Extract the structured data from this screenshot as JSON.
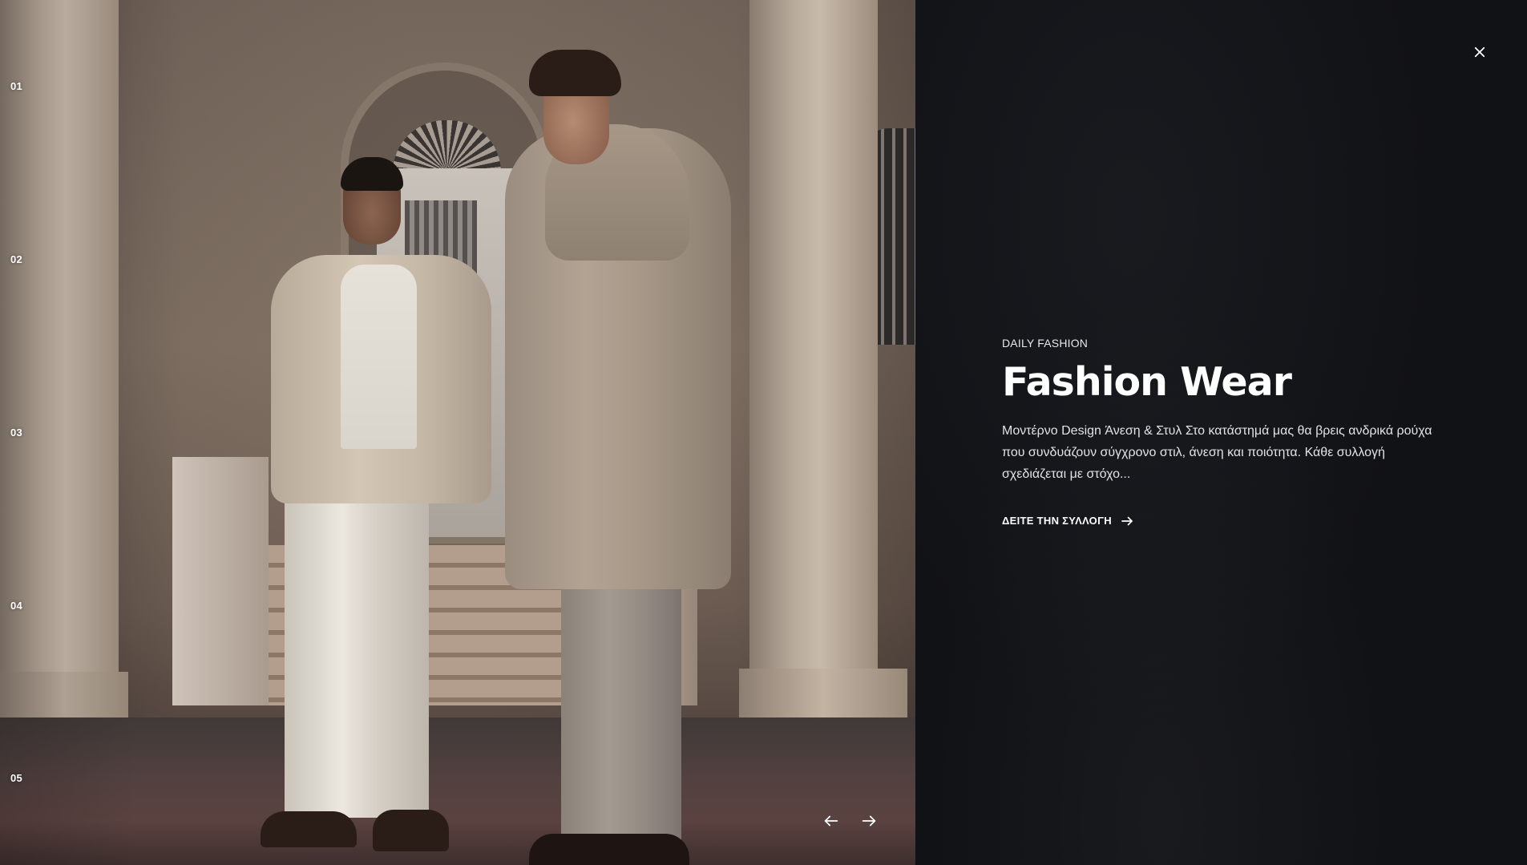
{
  "slider": {
    "numbers": [
      "01",
      "02",
      "03",
      "04",
      "05"
    ],
    "prev_icon": "arrow-left-icon",
    "next_icon": "arrow-right-icon"
  },
  "panel": {
    "close_icon": "close-icon",
    "eyebrow": "DAILY FASHION",
    "title": "Fashion Wear",
    "description": "Μοντέρνο Design Άνεση & Στυλ Στο κατάστημά μας θα βρεις ανδρικά ρούχα που συνδυάζουν σύγχρονο στιλ, άνεση και ποιότητα. Κάθε συλλογή σχεδιάζεται με στόχο...",
    "cta_label": "ΔΕΙΤΕ ΤΗΝ ΣΥΛΛΟΓΗ",
    "cta_icon": "arrow-right-icon"
  },
  "colors": {
    "panel_background": "#111216",
    "text": "#ffffff"
  }
}
